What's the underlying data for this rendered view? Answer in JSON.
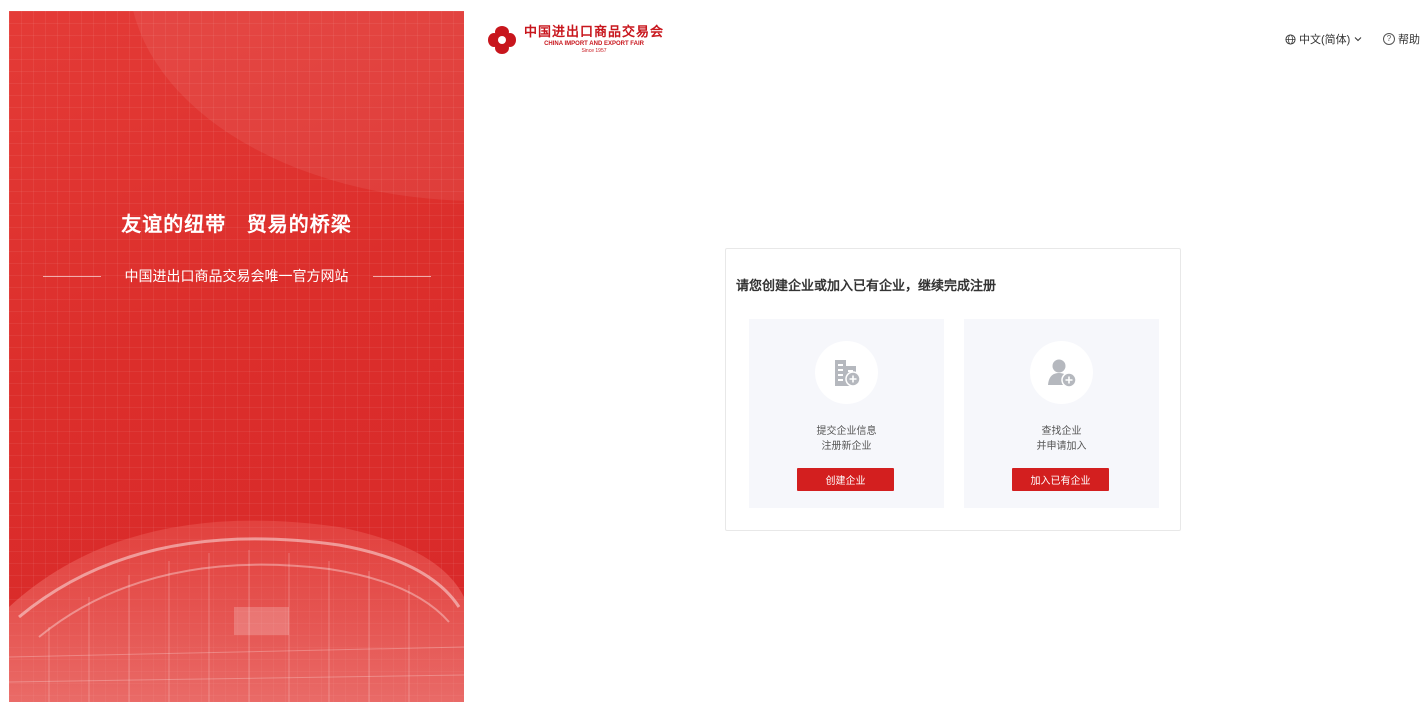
{
  "brand": {
    "logo_cn": "中国进出口商品交易会",
    "logo_en": "CHINA IMPORT AND EXPORT FAIR",
    "logo_since": "Since 1957",
    "accent": "#d31f1f"
  },
  "banner": {
    "slogan": "友谊的纽带 贸易的桥梁",
    "subtitle": "中国进出口商品交易会唯一官方网站"
  },
  "header": {
    "language_label": "中文(简体)",
    "help_label": "帮助"
  },
  "card": {
    "title": "请您创建企业或加入已有企业，继续完成注册",
    "options": [
      {
        "icon": "building-add-icon",
        "line1": "提交企业信息",
        "line2": "注册新企业",
        "button": "创建企业"
      },
      {
        "icon": "user-add-icon",
        "line1": "查找企业",
        "line2": "并申请加入",
        "button": "加入已有企业"
      }
    ]
  }
}
